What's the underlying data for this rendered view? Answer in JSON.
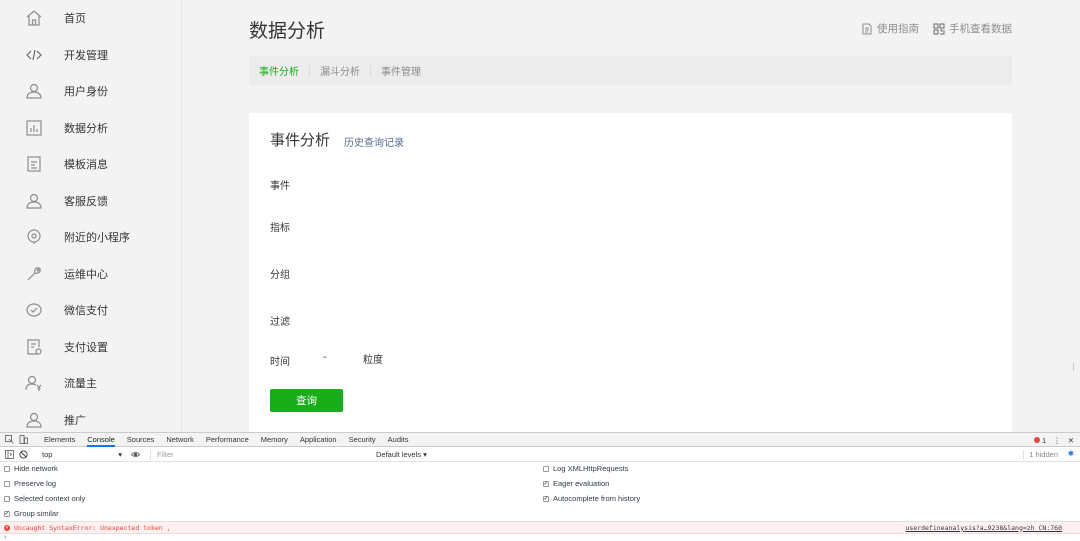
{
  "sidebar": {
    "items": [
      {
        "label": "首页",
        "icon": "home-icon"
      },
      {
        "label": "开发管理",
        "icon": "code-icon"
      },
      {
        "label": "用户身份",
        "icon": "user-icon"
      },
      {
        "label": "数据分析",
        "icon": "chart-icon"
      },
      {
        "label": "模板消息",
        "icon": "document-icon"
      },
      {
        "label": "客服反馈",
        "icon": "user-icon"
      },
      {
        "label": "附近的小程序",
        "icon": "location-icon"
      },
      {
        "label": "运维中心",
        "icon": "wrench-icon"
      },
      {
        "label": "微信支付",
        "icon": "pay-icon"
      },
      {
        "label": "支付设置",
        "icon": "pay-settings-icon"
      },
      {
        "label": "流量主",
        "icon": "user-yen-icon"
      },
      {
        "label": "推广",
        "icon": "user-icon"
      }
    ]
  },
  "header": {
    "title": "数据分析",
    "guide_link": "使用指南",
    "mobile_link": "手机查看数据"
  },
  "subtabs": [
    "事件分析",
    "漏斗分析",
    "事件管理"
  ],
  "card": {
    "title": "事件分析",
    "history_link": "历史查询记录",
    "field_event": "事件",
    "field_metric": "指标",
    "field_group": "分组",
    "field_filter": "过滤",
    "field_time": "时间",
    "time_separator": "-",
    "field_granularity": "粒度",
    "query_button": "查询"
  },
  "devtools": {
    "tabs": [
      "Elements",
      "Console",
      "Sources",
      "Network",
      "Performance",
      "Memory",
      "Application",
      "Security",
      "Audits"
    ],
    "active_tab": "Console",
    "error_count": "1",
    "context": "top",
    "filter_placeholder": "Filter",
    "levels": "Default levels ▾",
    "hidden": "1 hidden",
    "options_left": [
      {
        "label": "Hide network",
        "checked": false
      },
      {
        "label": "Preserve log",
        "checked": false
      },
      {
        "label": "Selected context only",
        "checked": false
      },
      {
        "label": "Group similar",
        "checked": true
      }
    ],
    "options_right": [
      {
        "label": "Log XMLHttpRequests",
        "checked": false
      },
      {
        "label": "Eager evaluation",
        "checked": true
      },
      {
        "label": "Autocomplete from history",
        "checked": true
      }
    ],
    "error_message": "Uncaught SyntaxError: Unexpected token ,",
    "error_source": "userdefineanalysis?a…9238&lang=zh_CN:760",
    "prompt": "›"
  },
  "colors": {
    "accent_green": "#1aad19",
    "link_blue": "#576b95",
    "error_red": "#e8453c"
  }
}
